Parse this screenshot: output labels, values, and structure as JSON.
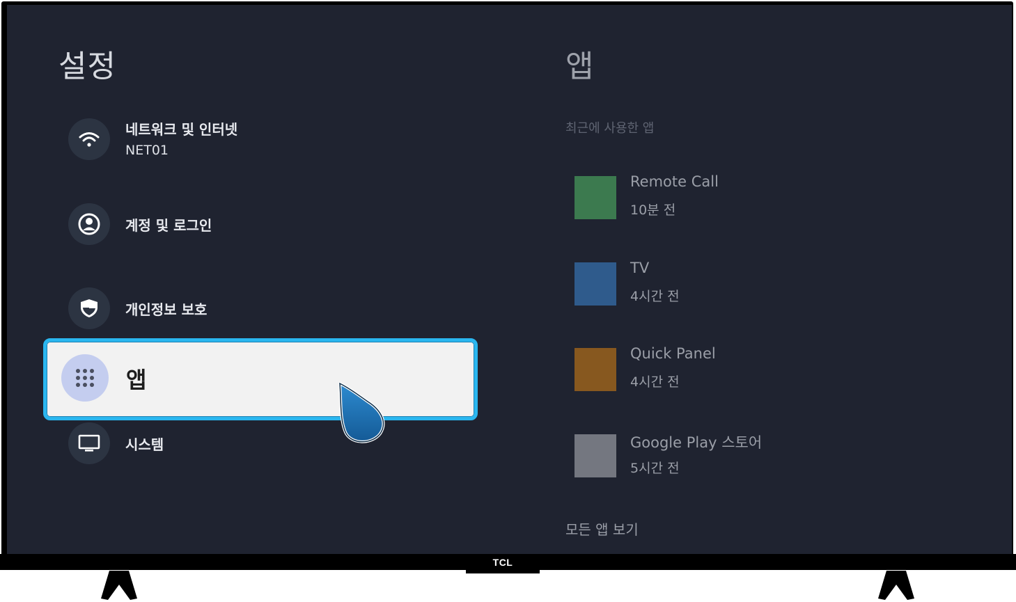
{
  "left_panel": {
    "title": "설정",
    "items": [
      {
        "label": "네트워크 및 인터넷",
        "sublabel": "NET01",
        "icon": "wifi-icon"
      },
      {
        "label": "계정 및 로그인",
        "icon": "account-circle-icon"
      },
      {
        "label": "개인정보 보호",
        "icon": "shield-icon"
      },
      {
        "label": "앱",
        "icon": "apps-grid-icon",
        "selected": true
      },
      {
        "label": "시스템",
        "icon": "monitor-icon"
      }
    ]
  },
  "right_panel": {
    "title": "앱",
    "section_label": "최근에 사용한 앱",
    "recent_apps": [
      {
        "name": "Remote Call",
        "time": "10분 전",
        "color": "#3c7a4f"
      },
      {
        "name": "TV",
        "time": "4시간 전",
        "color": "#2f5b8c"
      },
      {
        "name": "Quick Panel",
        "time": "4시간 전",
        "color": "#87581f"
      },
      {
        "name": "Google Play 스토어",
        "time": "5시간 전",
        "color": "#747780"
      }
    ],
    "see_all": "모든 앱 보기"
  },
  "brand": "TCL",
  "colors": {
    "screen_bg": "#1f2330",
    "focus_border": "#2ab6ef",
    "selected_bg": "#f2f2f2",
    "selected_icon_bg": "#c4cdef",
    "cursor": "#1b74b6"
  }
}
